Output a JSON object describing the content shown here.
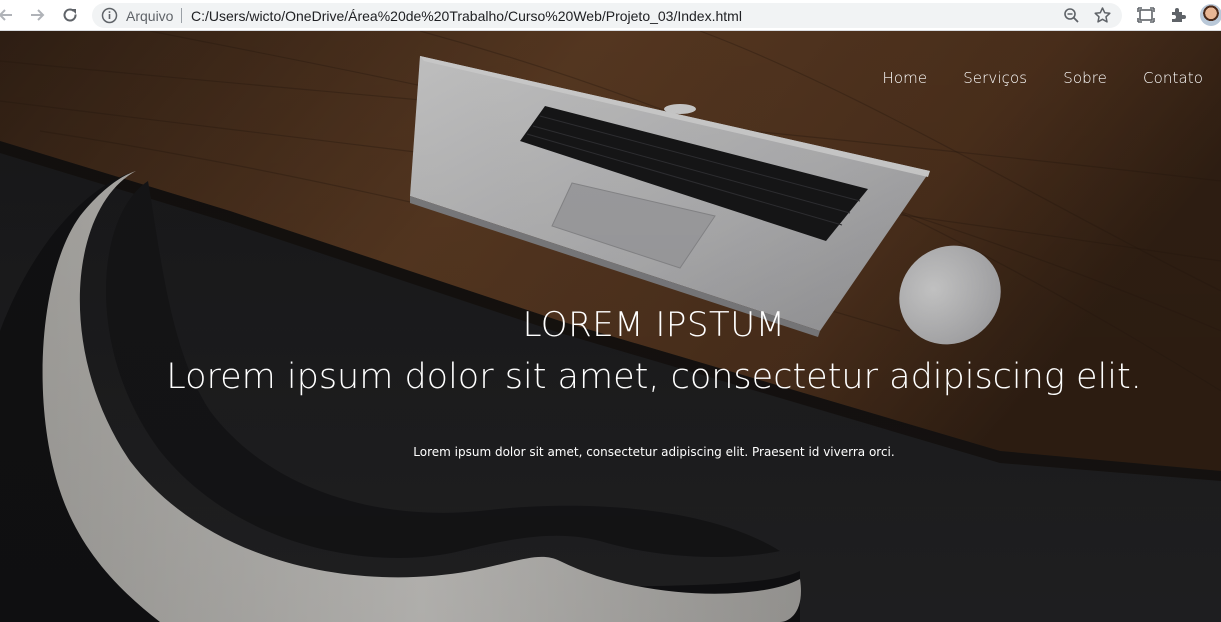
{
  "browser": {
    "scheme_label": "Arquivo",
    "url": "C:/Users/wicto/OneDrive/Área%20de%20Trabalho/Curso%20Web/Projeto_03/Index.html",
    "icons": [
      "back-arrow-icon",
      "forward-arrow-icon",
      "reload-icon",
      "info-icon",
      "zoom-icon",
      "star-icon",
      "cast-icon",
      "extensions-icon",
      "profile-avatar"
    ]
  },
  "nav": {
    "items": [
      {
        "label": "Home"
      },
      {
        "label": "Serviços"
      },
      {
        "label": "Sobre"
      },
      {
        "label": "Contato"
      }
    ]
  },
  "hero": {
    "title": "LOREM IPSTUM",
    "subtitle": "Lorem ipsum dolor sit amet, consectetur adipiscing elit.",
    "paragraph": "Lorem ipsum dolor sit amet, consectetur adipiscing elit. Praesent id viverra orci."
  },
  "colors": {
    "chrome_bg": "#ffffff",
    "omnibox_bg": "#f1f3f4",
    "text_white": "#ffffff",
    "desk_wood": "#5a3a24",
    "chair_white": "#e8e6e2"
  }
}
